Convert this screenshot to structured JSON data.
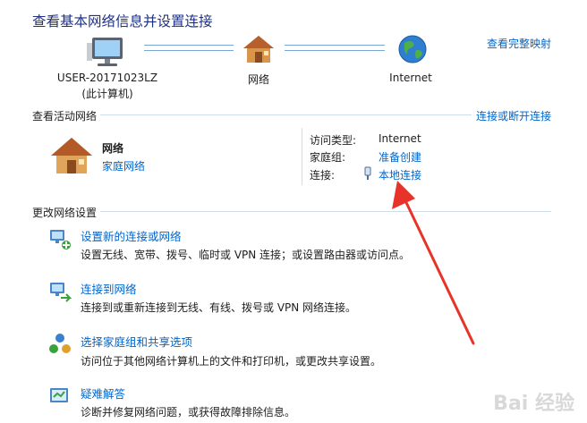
{
  "header": {
    "title": "查看基本网络信息并设置连接",
    "full_map_link": "查看完整映射"
  },
  "map": {
    "computer": {
      "name": "USER-20171023LZ",
      "sub": "(此计算机)",
      "icon": "computer-icon"
    },
    "network": {
      "name": "网络",
      "icon": "house-icon"
    },
    "internet": {
      "name": "Internet",
      "icon": "globe-icon"
    }
  },
  "active": {
    "heading": "查看活动网络",
    "connect_link": "连接或断开连接",
    "network_name": "网络",
    "network_type_link": "家庭网络",
    "access_type_label": "访问类型:",
    "access_type_value": "Internet",
    "homegroup_label": "家庭组:",
    "homegroup_link": "准备创建",
    "connection_label": "连接:",
    "connection_link": "本地连接"
  },
  "settings": {
    "heading": "更改网络设置",
    "tasks": [
      {
        "title": "设置新的连接或网络",
        "desc": "设置无线、宽带、拨号、临时或 VPN 连接；或设置路由器或访问点。",
        "icon": "new-connection-icon"
      },
      {
        "title": "连接到网络",
        "desc": "连接到或重新连接到无线、有线、拨号或 VPN 网络连接。",
        "icon": "connect-network-icon"
      },
      {
        "title": "选择家庭组和共享选项",
        "desc": "访问位于其他网络计算机上的文件和打印机，或更改共享设置。",
        "icon": "homegroup-icon"
      },
      {
        "title": "疑难解答",
        "desc": "诊断并修复网络问题，或获得故障排除信息。",
        "icon": "troubleshoot-icon"
      }
    ]
  },
  "annotation": {
    "arrow_color": "#e8332a"
  },
  "watermark": "Bai 经验"
}
